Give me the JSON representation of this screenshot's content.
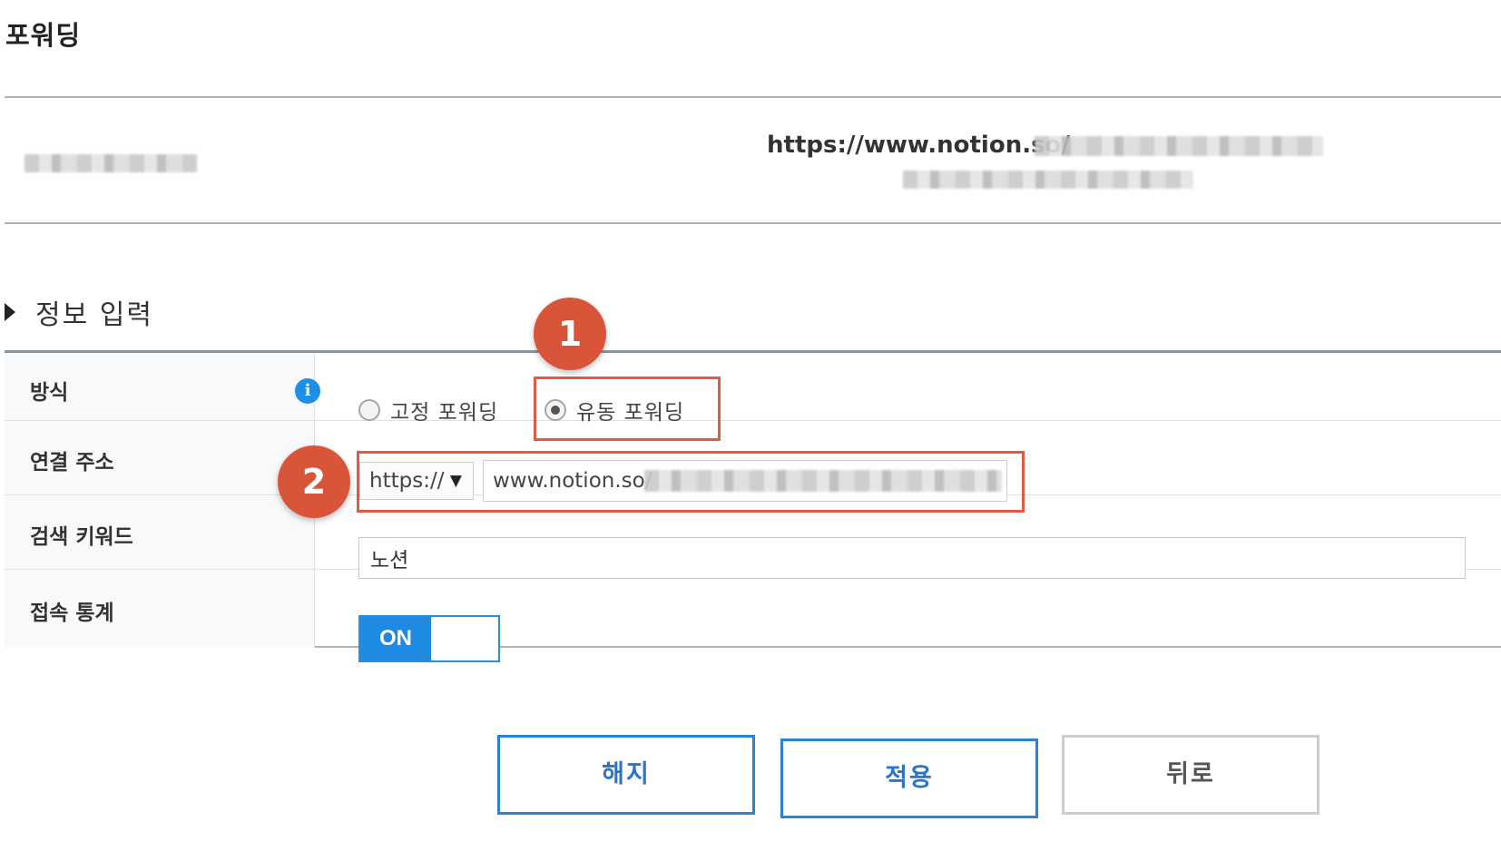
{
  "page": {
    "title": "포워딩"
  },
  "summary": {
    "url_prefix": "https://www.notion.so/"
  },
  "section": {
    "title": "정보 입력"
  },
  "form": {
    "method": {
      "label": "방식",
      "info_icon": "info-icon",
      "options": [
        {
          "label": "고정 포워딩",
          "selected": false
        },
        {
          "label": "유동 포워딩",
          "selected": true
        }
      ]
    },
    "link_address": {
      "label": "연결 주소",
      "protocol": "https://",
      "protocol_arrow": "▼",
      "value": "www.notion.so/"
    },
    "keyword": {
      "label": "검색 키워드",
      "value": "노션"
    },
    "stats": {
      "label": "접속 통계",
      "toggle": "ON",
      "enabled": true
    }
  },
  "annotations": {
    "badge_1": "1",
    "badge_2": "2"
  },
  "buttons": {
    "cancel": "해지",
    "apply": "적용",
    "back": "뒤로"
  },
  "colors": {
    "accent_blue": "#1f8ae2",
    "highlight_red": "#e05a3c",
    "badge_red": "#d9553a"
  }
}
